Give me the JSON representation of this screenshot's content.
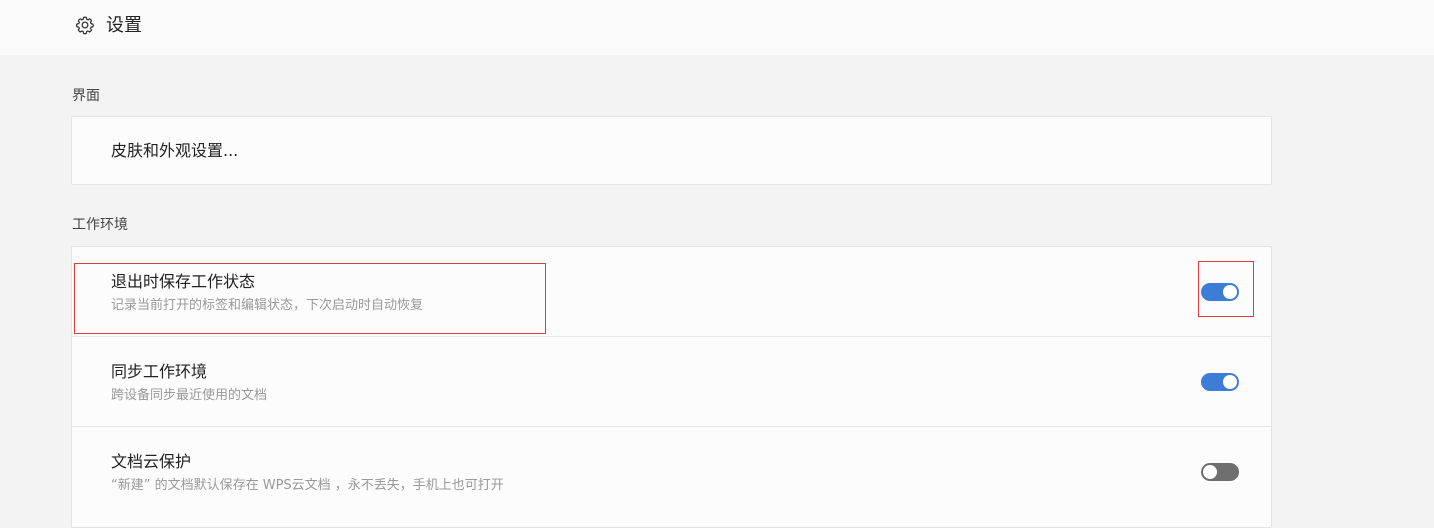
{
  "header": {
    "icon": "gear-icon",
    "title": "设置"
  },
  "sections": {
    "interface": {
      "label": "界面",
      "skin_link": "皮肤和外观设置..."
    },
    "workspace": {
      "label": "工作环境",
      "items": [
        {
          "title": "退出时保存工作状态",
          "description": "记录当前打开的标签和编辑状态，下次启动时自动恢复",
          "enabled": true
        },
        {
          "title": "同步工作环境",
          "description": "跨设备同步最近使用的文档",
          "enabled": true
        },
        {
          "title": "文档云保护",
          "description": "“新建” 的文档默认保存在 WPS云文档 ，永不丢失，手机上也可打开",
          "enabled": false
        }
      ]
    }
  },
  "colors": {
    "toggle_on": "#3d7dd8",
    "toggle_off": "#6f6f6f",
    "highlight": "#e23b3b"
  }
}
